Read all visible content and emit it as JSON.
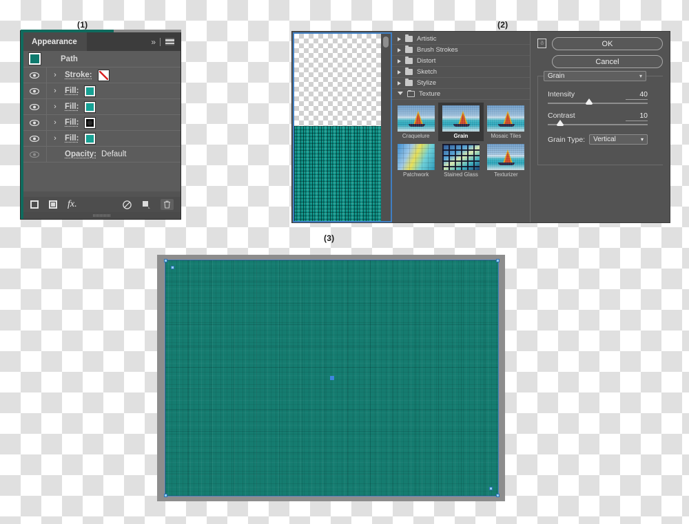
{
  "figure_labels": {
    "one": "(1)",
    "two": "(2)",
    "three": "(3)"
  },
  "appearance_panel": {
    "tab_title": "Appearance",
    "header_icons": {
      "collapse": "double-chevron-right-icon",
      "menu": "panel-menu-icon"
    },
    "target_row": {
      "label": "Path",
      "swatch_color": "#0e7a6e"
    },
    "rows": [
      {
        "attribute": "Stroke:",
        "swatch": "none",
        "swatch_color": "#ffffff",
        "visible": true,
        "expandable": true
      },
      {
        "attribute": "Fill:",
        "swatch": "color",
        "swatch_color": "#17a093",
        "visible": true,
        "expandable": true
      },
      {
        "attribute": "Fill:",
        "swatch": "color",
        "swatch_color": "#16a195",
        "visible": true,
        "expandable": true
      },
      {
        "attribute": "Fill:",
        "swatch": "black",
        "swatch_color": "#111111",
        "visible": true,
        "expandable": true
      },
      {
        "attribute": "Fill:",
        "swatch": "color",
        "swatch_color": "#16a195",
        "visible": true,
        "expandable": true
      }
    ],
    "opacity_row": {
      "label": "Opacity:",
      "value": "Default"
    },
    "footer_buttons": [
      {
        "name": "add-new-stroke",
        "icon": "square-outline-icon"
      },
      {
        "name": "add-new-fill",
        "icon": "filled-square-icon"
      },
      {
        "name": "add-new-effect",
        "icon": "fx-icon",
        "label": "fx."
      },
      {
        "name": "clear-appearance",
        "icon": "no-symbol-icon"
      },
      {
        "name": "duplicate-item",
        "icon": "duplicate-icon"
      },
      {
        "name": "delete-item",
        "icon": "trash-icon"
      }
    ]
  },
  "filter_gallery": {
    "preview": {
      "name": "filter-preview",
      "top_region": "transparency-checkerboard",
      "bottom_region": "teal-vertical-grain-texture"
    },
    "categories": [
      {
        "label": "Artistic",
        "expanded": false
      },
      {
        "label": "Brush Strokes",
        "expanded": false
      },
      {
        "label": "Distort",
        "expanded": false
      },
      {
        "label": "Sketch",
        "expanded": false
      },
      {
        "label": "Stylize",
        "expanded": false
      },
      {
        "label": "Texture",
        "expanded": true
      }
    ],
    "texture_filters": [
      {
        "label": "Craquelure",
        "selected": false,
        "style": "boat"
      },
      {
        "label": "Grain",
        "selected": true,
        "style": "boat"
      },
      {
        "label": "Mosaic Tiles",
        "selected": false,
        "style": "boat"
      },
      {
        "label": "Patchwork",
        "selected": false,
        "style": "patchwork"
      },
      {
        "label": "Stained Glass",
        "selected": false,
        "style": "stained"
      },
      {
        "label": "Texturizer",
        "selected": false,
        "style": "boat"
      }
    ],
    "buttons": {
      "ok": "OK",
      "cancel": "Cancel",
      "stack_icon": "new-effect-layer-icon"
    },
    "settings": {
      "filter_select": "Grain",
      "intensity": {
        "label": "Intensity",
        "value": "40",
        "slider_percent": 40
      },
      "contrast": {
        "label": "Contrast",
        "value": "10",
        "slider_percent": 10
      },
      "grain_type": {
        "label": "Grain Type:",
        "value": "Vertical"
      }
    }
  },
  "artboard": {
    "name": "illustrator-artboard",
    "fill_color": "#157c70",
    "selection_color": "#4a7fc1",
    "anchor_color": "#8fd2f0",
    "center_point_color": "#3f86e0",
    "canvas_background": "#8d8d8d"
  }
}
